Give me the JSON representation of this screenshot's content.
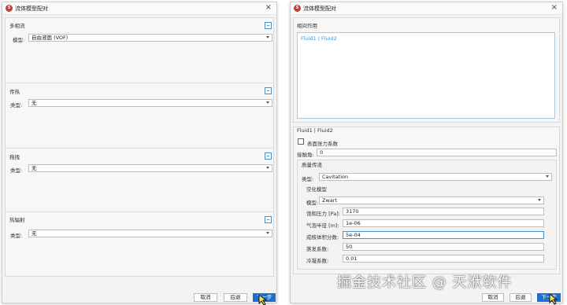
{
  "left_dialog": {
    "title": "流体模型配对",
    "close": "×",
    "multiphase": {
      "heading": "多相流",
      "model_label": "模型:",
      "model_value": "自由液面 (VOF)"
    },
    "heat_transfer": {
      "heading": "传热",
      "type_label": "类型:",
      "type_value": "无"
    },
    "drag": {
      "heading": "拖拽",
      "type_label": "类型:",
      "type_value": "无"
    },
    "thermal_radiation": {
      "heading": "热辐射",
      "type_label": "类型:",
      "type_value": "无"
    },
    "buttons": {
      "cancel": "取消",
      "back": "后退",
      "next": "下一步"
    }
  },
  "right_dialog": {
    "title": "流体模型配对",
    "close": "×",
    "interaction": {
      "heading": "相间作用",
      "items": [
        "Fluid1 | Fluid2"
      ]
    },
    "pair": {
      "heading": "Fluid1 | Fluid2",
      "surface_tension_label": "表面张力系数",
      "contact_angle_label": "接触角:",
      "contact_angle_value": "0",
      "mass_transfer": {
        "heading": "质量传递",
        "type_label": "类型:",
        "type_value": "Cavitation",
        "cavitation_model": {
          "heading": "空化模型",
          "model_label": "模型:",
          "model_value": "Zwart",
          "fields": [
            {
              "label": "饱和压力 [Pa]:",
              "value": "3170"
            },
            {
              "label": "气泡半径 [m]:",
              "value": "1e-06"
            },
            {
              "label": "成核体积分数:",
              "value": "5e-04"
            },
            {
              "label": "蒸发系数:",
              "value": "50"
            },
            {
              "label": "冷凝系数:",
              "value": "0.01"
            }
          ]
        }
      }
    },
    "buttons": {
      "cancel": "取消",
      "back": "后退",
      "next": "下一步"
    }
  },
  "watermark": "掘金技术社区 @ 天洑软件",
  "colors": {
    "accent": "#1f6fd1",
    "list_text": "#4a90c8",
    "dialog_bg": "#f3f3f3"
  }
}
